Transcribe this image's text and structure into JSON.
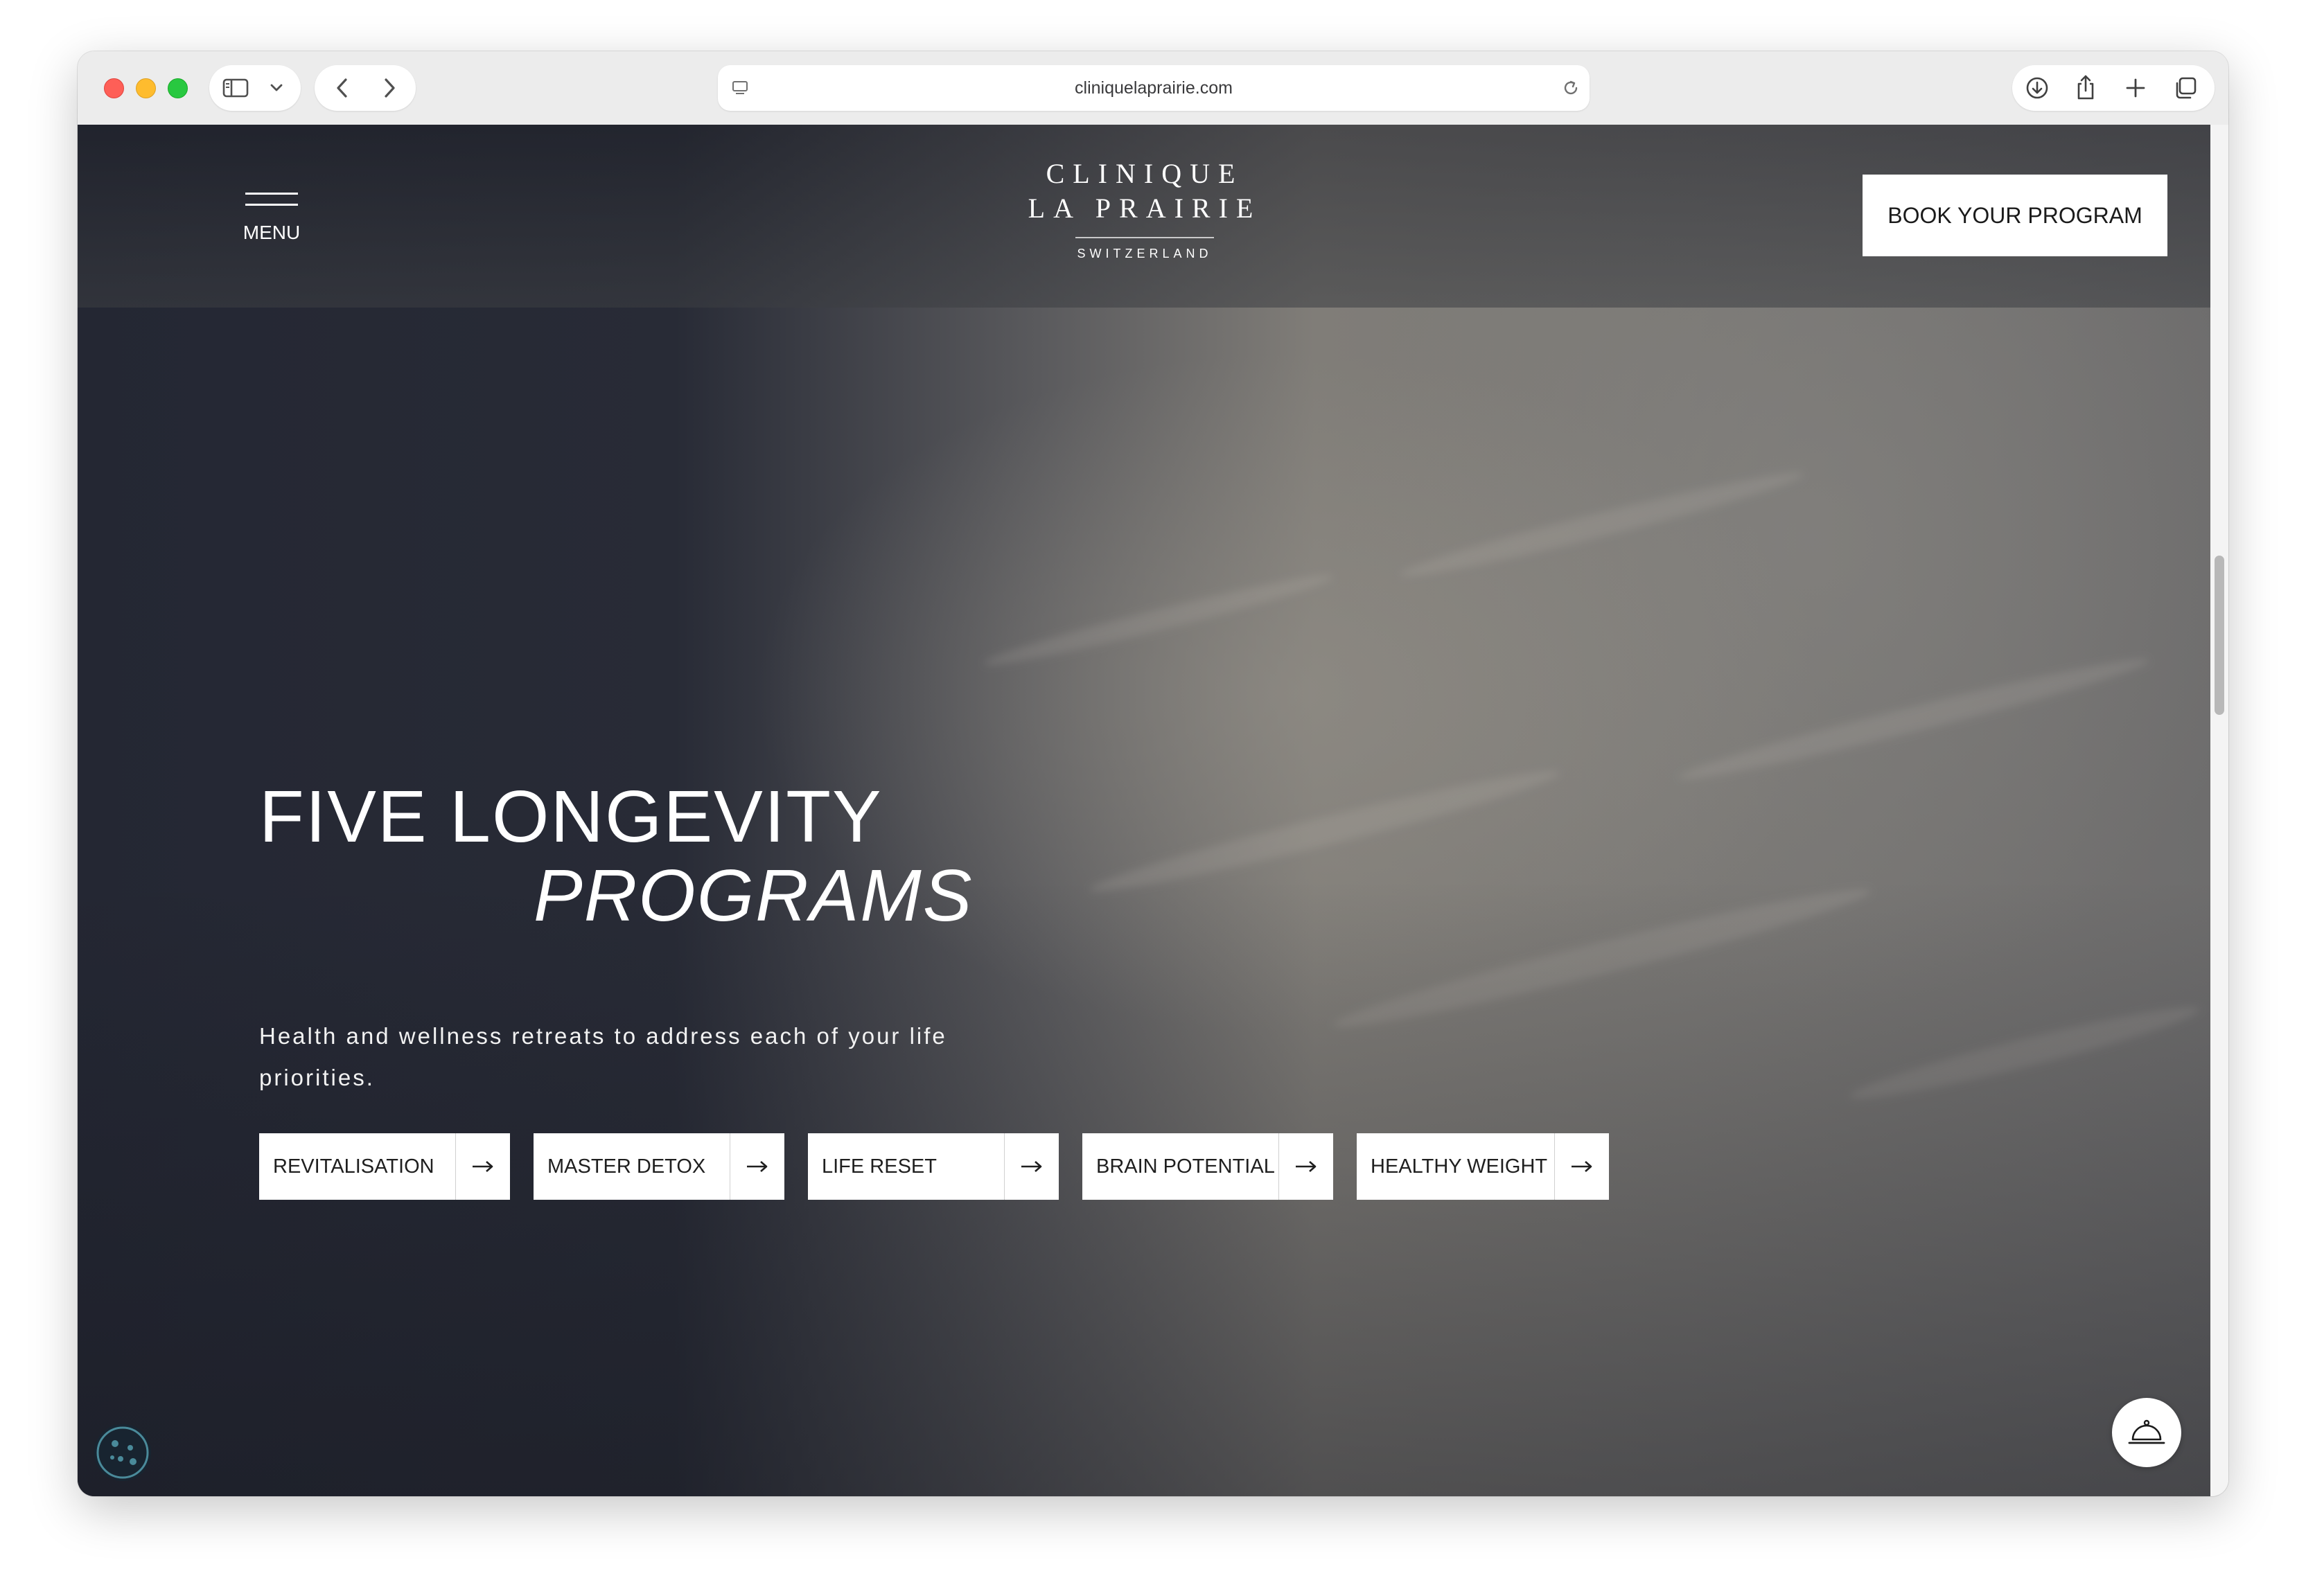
{
  "browser": {
    "url": "cliniquelaprairie.com",
    "icons": {
      "sidebar": "sidebar-icon",
      "chevron": "chevron-down-icon",
      "back": "back-arrow-icon",
      "forward": "forward-arrow-icon",
      "page": "page-icon",
      "reload": "reload-icon",
      "download": "download-icon",
      "share": "share-icon",
      "new_tab": "plus-icon",
      "tabs": "tabs-overview-icon"
    }
  },
  "header": {
    "menu_label": "MENU",
    "logo": {
      "line1": "CLINIQUE",
      "line2": "LA PRAIRIE",
      "sub": "SWITZERLAND"
    },
    "book_label": "BOOK YOUR PROGRAM"
  },
  "hero": {
    "title_line1": "FIVE LONGEVITY",
    "title_line2": "PROGRAMS",
    "subtitle": "Health and wellness retreats to address each of your life priorities."
  },
  "programs": [
    {
      "label": "REVITALISATION"
    },
    {
      "label": "MASTER DETOX"
    },
    {
      "label": "LIFE RESET"
    },
    {
      "label": "BRAIN POTENTIAL"
    },
    {
      "label": "HEALTHY WEIGHT"
    }
  ],
  "floating": {
    "cookie_icon": "cookie-icon",
    "concierge_icon": "concierge-bell-icon"
  },
  "colors": {
    "button_bg": "#ffffff",
    "text_on_dark": "#ffffff",
    "hero_dark": "#242733"
  }
}
